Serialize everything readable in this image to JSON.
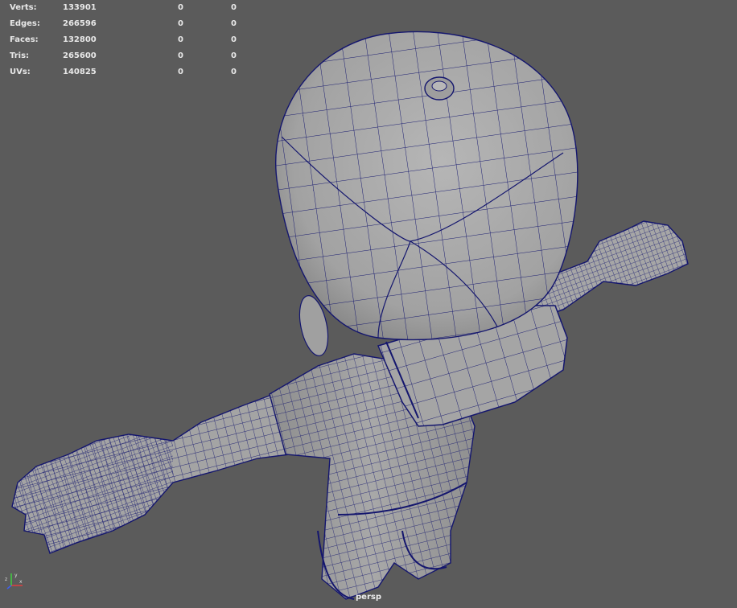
{
  "hud": {
    "rows": [
      {
        "label": "Verts:",
        "total": "133901",
        "a": "0",
        "b": "0"
      },
      {
        "label": "Edges:",
        "total": "266596",
        "a": "0",
        "b": "0"
      },
      {
        "label": "Faces:",
        "total": "132800",
        "a": "0",
        "b": "0"
      },
      {
        "label": "Tris:",
        "total": "265600",
        "a": "0",
        "b": "0"
      },
      {
        "label": "UVs:",
        "total": "140825",
        "a": "0",
        "b": "0"
      }
    ]
  },
  "camera": {
    "name": "persp"
  },
  "axis": {
    "x_label": "x",
    "y_label": "y",
    "z_label": "z"
  },
  "colors": {
    "background": "#5b5b5b",
    "surface": "#a9a9a9",
    "wire": "#14166e",
    "hud_text": "#e8e8e8"
  }
}
